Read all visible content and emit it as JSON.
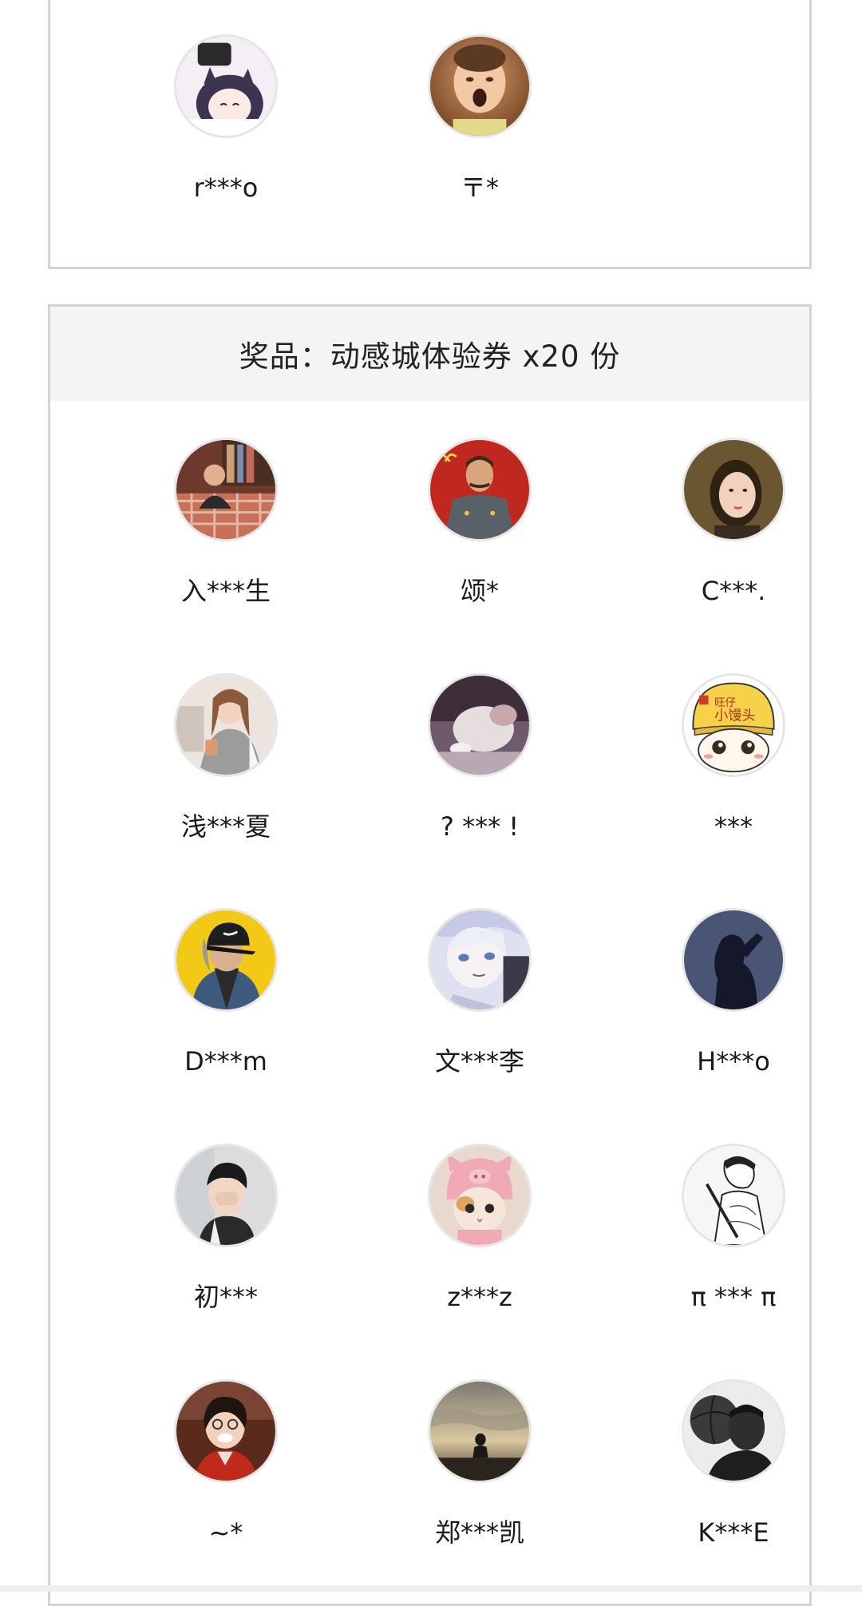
{
  "top_section": {
    "winners": [
      {
        "name": "r***o",
        "avatar_icon": "anime-cat-girl-avatar",
        "bg": "#efeaf2"
      },
      {
        "name": "〒*",
        "avatar_icon": "yawning-baby-avatar",
        "bg": "#b07a4c"
      }
    ]
  },
  "prize_section": {
    "header": "奖品：动感城体验券 x20 份",
    "winners": [
      {
        "name": "入***生",
        "avatar_icon": "man-on-sofa-avatar",
        "bg": "#b86c5c"
      },
      {
        "name": "颂*",
        "avatar_icon": "soldier-portrait-avatar",
        "bg": "#c0281f"
      },
      {
        "name": "C***.",
        "avatar_icon": "girl-portrait-avatar",
        "bg": "#5a4a2c"
      },
      {
        "name": "浅***夏",
        "avatar_icon": "woman-with-cup-avatar",
        "bg": "#e9dcd2"
      },
      {
        "name": "? *** !",
        "avatar_icon": "blurry-photo-avatar",
        "bg": "#8a7a88"
      },
      {
        "name": "***",
        "avatar_icon": "cartoon-mascot-avatar",
        "bg": "#f6d24a"
      },
      {
        "name": "D***m",
        "avatar_icon": "cap-wearing-man-avatar",
        "bg": "#f2c916"
      },
      {
        "name": "文***李",
        "avatar_icon": "anime-boy-avatar",
        "bg": "#d9dcef"
      },
      {
        "name": "H***o",
        "avatar_icon": "silhouette-man-avatar",
        "bg": "#3a4560"
      },
      {
        "name": "初***",
        "avatar_icon": "covering-face-avatar",
        "bg": "#d4d4d4"
      },
      {
        "name": "z***z",
        "avatar_icon": "cat-in-pig-hat-avatar",
        "bg": "#e8d2c8"
      },
      {
        "name": "π *** π",
        "avatar_icon": "sketch-warrior-avatar",
        "bg": "#f2f2f2"
      },
      {
        "name": "~*",
        "avatar_icon": "smiling-girl-avatar",
        "bg": "#6b3020"
      },
      {
        "name": "郑***凯",
        "avatar_icon": "sunset-silhouette-avatar",
        "bg": "#8e8570"
      },
      {
        "name": "K***E",
        "avatar_icon": "basketball-player-avatar",
        "bg": "#5c5c5c"
      }
    ]
  }
}
